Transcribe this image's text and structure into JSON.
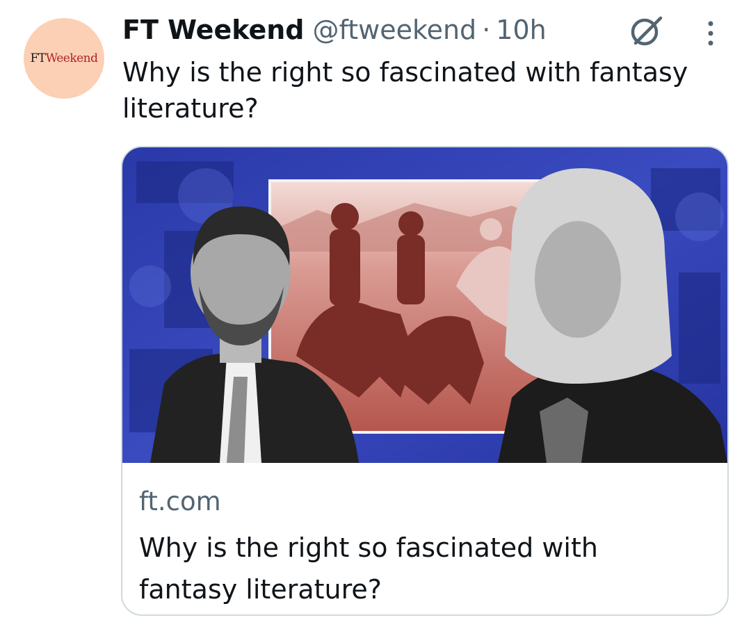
{
  "author": {
    "avatar_text_ft": "FT",
    "avatar_text_weekend": "Weekend",
    "display_name": "FT Weekend",
    "handle": "@ftweekend",
    "separator": "·",
    "time": "10h"
  },
  "tweet": {
    "text": "Why is the right so fascinated with fantasy literature?"
  },
  "card": {
    "domain": "ft.com",
    "title": "Why is the right so fascinated with fantasy literature?"
  },
  "icons": [
    "grok-icon",
    "more-options-icon"
  ],
  "colors": {
    "avatar_bg": "#fcd0b4",
    "ft_red": "#b0232a",
    "secondary_text": "#536471",
    "card_border": "#cfd9de",
    "image_blue": "#2f3fb0",
    "image_red": "#a8453f"
  }
}
